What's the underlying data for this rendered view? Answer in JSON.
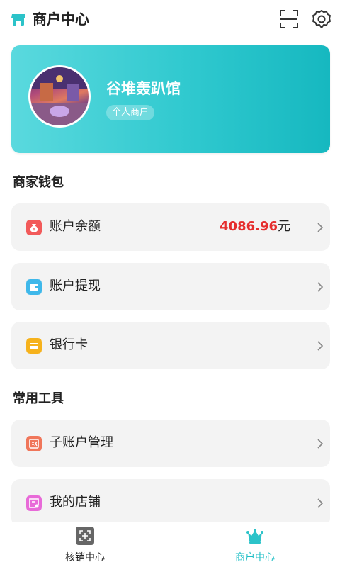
{
  "header": {
    "title": "商户中心",
    "logo_icon": "shop-icon",
    "scan_icon": "scan-icon",
    "settings_icon": "gear-icon"
  },
  "profile": {
    "name": "谷堆轰趴馆",
    "type_badge": "个人商户"
  },
  "sections": {
    "wallet_title": "商家钱包",
    "tools_title": "常用工具"
  },
  "wallet_items": [
    {
      "label": "账户余额",
      "amount": "4086.96",
      "unit": "元",
      "icon": "money-bag-icon",
      "icon_color": "#f25a5a"
    },
    {
      "label": "账户提现",
      "icon": "wallet-icon",
      "icon_color": "#3fb8ea"
    },
    {
      "label": "银行卡",
      "icon": "bank-card-icon",
      "icon_color": "#f6b21c"
    }
  ],
  "tool_items": [
    {
      "label": "子账户管理",
      "icon": "sub-account-icon",
      "icon_color": "#f0765a"
    },
    {
      "label": "我的店铺",
      "icon": "store-icon",
      "icon_color": "#e86ad8"
    }
  ],
  "tabs": [
    {
      "label": "核销中心",
      "icon": "verify-scan-icon",
      "active": false
    },
    {
      "label": "商户中心",
      "icon": "crown-icon",
      "active": true
    }
  ],
  "colors": {
    "accent": "#20bfc6",
    "amount": "#e52e2e",
    "row_bg": "#f3f3f3"
  }
}
